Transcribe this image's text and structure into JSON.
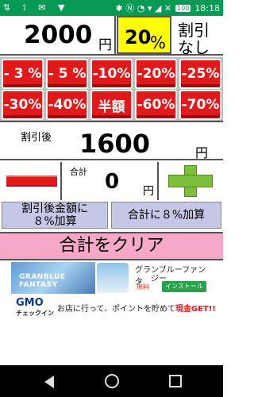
{
  "status_bar": {
    "left_icons": "⇅ ⟟ ✉ ▼",
    "right_icons": "✱ Ⓝ ◔ ▾ ◢ ✕",
    "battery": "100",
    "time": "18:18"
  },
  "price": {
    "value": "2000",
    "unit": "円"
  },
  "rate": {
    "value": "20",
    "unit": "%"
  },
  "no_discount": {
    "line1": "割引",
    "line2": "なし"
  },
  "discounts": [
    "- 3 %",
    "- 5 %",
    "-10%",
    "-20%",
    "-25%",
    "-30%",
    "-40%",
    "半額",
    "-60%",
    "-70%"
  ],
  "discounted": {
    "label": "割引後",
    "value": "1600",
    "unit": "円"
  },
  "total": {
    "label": "合計",
    "value": "0",
    "unit": "円"
  },
  "add_buttons": {
    "after_discount_l1": "割引後金額に",
    "after_discount_l2": "８%加算",
    "to_total": "合計に８%加算"
  },
  "clear_label": "合計をクリア",
  "ad_banner": {
    "logo": "GRANBLUE FANTASY",
    "title": "グランブルーファンタ",
    "subtitle": "ジー",
    "free": "無料",
    "install": "インストール"
  },
  "gmo_banner": {
    "logo": "GMO",
    "sub": "チェックイン",
    "text": "お店に行って、ポイントを貯めて",
    "highlight": "現金GET!!"
  },
  "colors": {
    "status_bar": "#079a55",
    "discount_red": "#e01a1a",
    "rate_yellow": "#ffff00",
    "add_purple": "#c6c6e6",
    "clear_pink": "#f5a8c8",
    "plus_green": "#7bbf3a"
  }
}
